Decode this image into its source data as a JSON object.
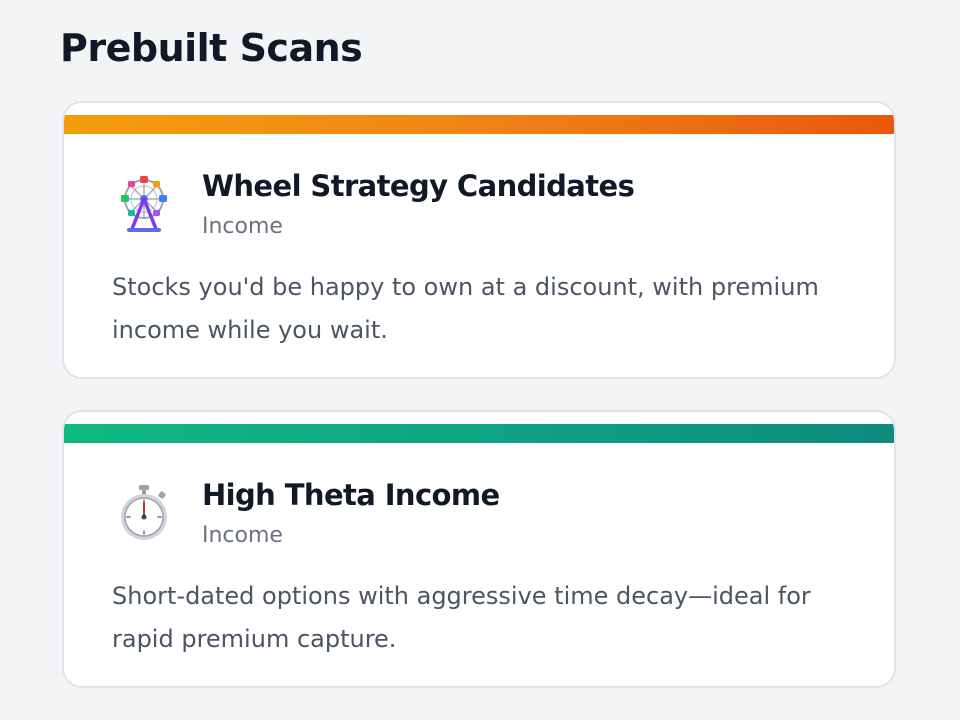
{
  "page": {
    "title": "Prebuilt Scans"
  },
  "scans": [
    {
      "icon": "ferris-wheel-icon",
      "accent_colors": [
        "#f59e0b",
        "#ea580c"
      ],
      "title": "Wheel Strategy Candidates",
      "category": "Income",
      "description": "Stocks you'd be happy to own at a discount, with premium income while you wait."
    },
    {
      "icon": "stopwatch-icon",
      "accent_colors": [
        "#10b981",
        "#0d8b7d"
      ],
      "title": "High Theta Income",
      "category": "Income",
      "description": "Short-dated options with aggressive time decay—ideal for rapid premium capture."
    }
  ]
}
